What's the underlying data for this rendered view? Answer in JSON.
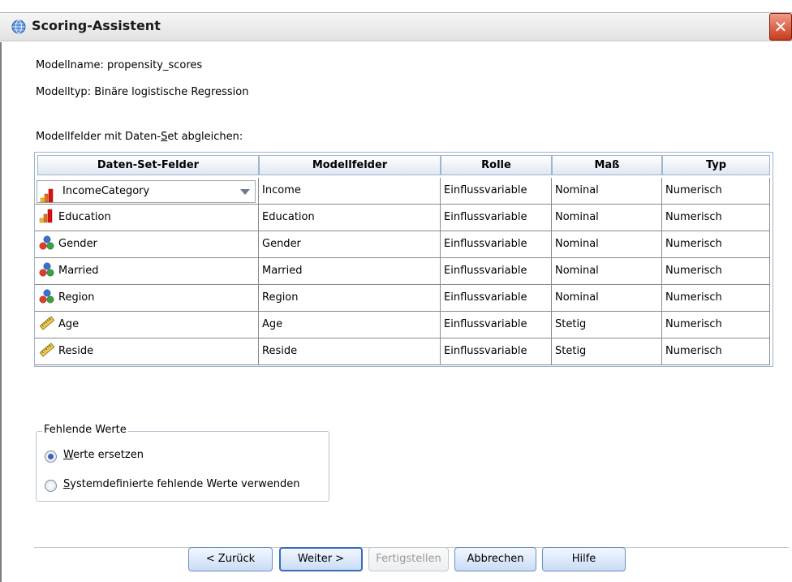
{
  "window": {
    "title": "Scoring-Assistent",
    "close_glyph": "✕"
  },
  "info": {
    "model_name": "Modellname: propensity_scores",
    "model_type": "Modelltyp: Binäre logistische Regression",
    "match_prefix": "Modellfelder mit Daten-",
    "match_underline": "S",
    "match_suffix": "et abgleichen:"
  },
  "table": {
    "headers": [
      "Daten-Set-Felder",
      "Modellfelder",
      "Rolle",
      "Maß",
      "Typ"
    ],
    "rows": [
      {
        "field": "IncomeCategory",
        "icon": "ordinal-bars-icon",
        "model": "Income",
        "role": "Einflussvariable",
        "measure": "Nominal",
        "type": "Numerisch"
      },
      {
        "field": "Education",
        "icon": "ordinal-bars-icon",
        "model": "Education",
        "role": "Einflussvariable",
        "measure": "Nominal",
        "type": "Numerisch"
      },
      {
        "field": "Gender",
        "icon": "nominal-balls-icon",
        "model": "Gender",
        "role": "Einflussvariable",
        "measure": "Nominal",
        "type": "Numerisch"
      },
      {
        "field": "Married",
        "icon": "nominal-balls-icon",
        "model": "Married",
        "role": "Einflussvariable",
        "measure": "Nominal",
        "type": "Numerisch"
      },
      {
        "field": "Region",
        "icon": "nominal-balls-icon",
        "model": "Region",
        "role": "Einflussvariable",
        "measure": "Nominal",
        "type": "Numerisch"
      },
      {
        "field": "Age",
        "icon": "scale-ruler-icon",
        "model": "Age",
        "role": "Einflussvariable",
        "measure": "Stetig",
        "type": "Numerisch"
      },
      {
        "field": "Reside",
        "icon": "scale-ruler-icon",
        "model": "Reside",
        "role": "Einflussvariable",
        "measure": "Stetig",
        "type": "Numerisch"
      }
    ]
  },
  "missing": {
    "group_title": "Fehlende Werte",
    "option1_u": "W",
    "option1_rest": "erte ersetzen",
    "option2_u": "S",
    "option2_rest": "ystemdefinierte fehlende Werte verwenden",
    "selected": "option1"
  },
  "buttons": {
    "back": "< Zurück",
    "next": "Weiter >",
    "finish": "Fertigstellen",
    "cancel": "Abbrechen",
    "help": "Hilfe"
  }
}
